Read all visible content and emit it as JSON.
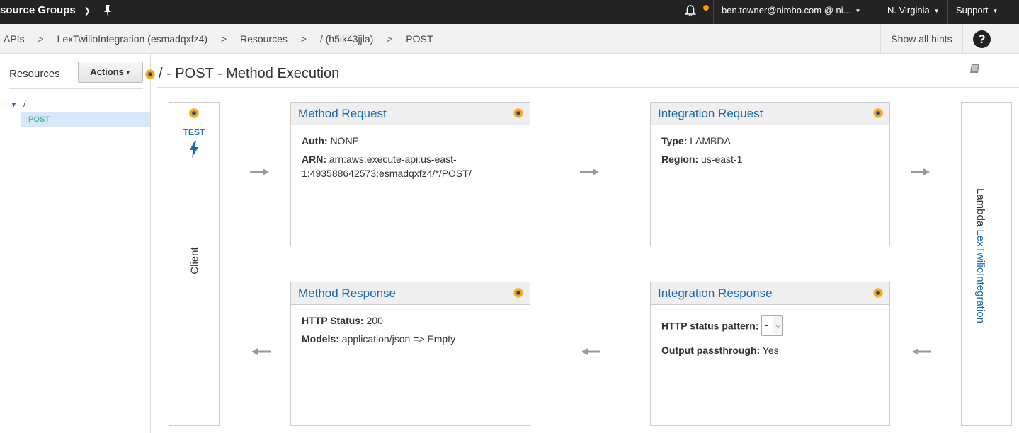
{
  "topnav": {
    "resource_groups": "source Groups",
    "account": "ben.towner@nimbo.com @ ni...",
    "region": "N. Virginia",
    "support": "Support",
    "icons": [
      "pin-icon",
      "bell-icon",
      "chevron-down-icon"
    ],
    "notification_dot_color": "#f90"
  },
  "breadcrumb": {
    "items": [
      "APIs",
      "LexTwilioIntegration (esmadqxfz4)",
      "Resources",
      "/ (h5ik43jjla)",
      "POST"
    ],
    "separator": ">",
    "hints_label": "Show all hints",
    "help_label": "?"
  },
  "sidebar": {
    "title": "Resources",
    "actions_label": "Actions",
    "tree": {
      "root": "/",
      "children": [
        "POST"
      ]
    }
  },
  "main": {
    "title": "/ - POST - Method Execution",
    "client": {
      "test_label": "TEST",
      "label": "Client"
    },
    "lambda": {
      "prefix": "Lambda",
      "function": "LexTwilioIntegration"
    },
    "method_request": {
      "title": "Method Request",
      "auth_label": "Auth:",
      "auth_value": "NONE",
      "arn_label": "ARN:",
      "arn_value": "arn:aws:execute-api:us-east-1:493588642573:esmadqxfz4/*/POST/"
    },
    "integration_request": {
      "title": "Integration Request",
      "type_label": "Type:",
      "type_value": "LAMBDA",
      "region_label": "Region:",
      "region_value": "us-east-1"
    },
    "method_response": {
      "title": "Method Response",
      "status_label": "HTTP Status:",
      "status_value": "200",
      "models_label": "Models:",
      "models_value": "application/json => Empty"
    },
    "integration_response": {
      "title": "Integration Response",
      "pattern_label": "HTTP status pattern:",
      "pattern_value": "-",
      "passthrough_label": "Output passthrough:",
      "passthrough_value": "Yes"
    },
    "colors": {
      "link_blue": "#1a6aaf",
      "post_green": "#4cbb87",
      "hint_orange": "#f7a21b"
    }
  }
}
